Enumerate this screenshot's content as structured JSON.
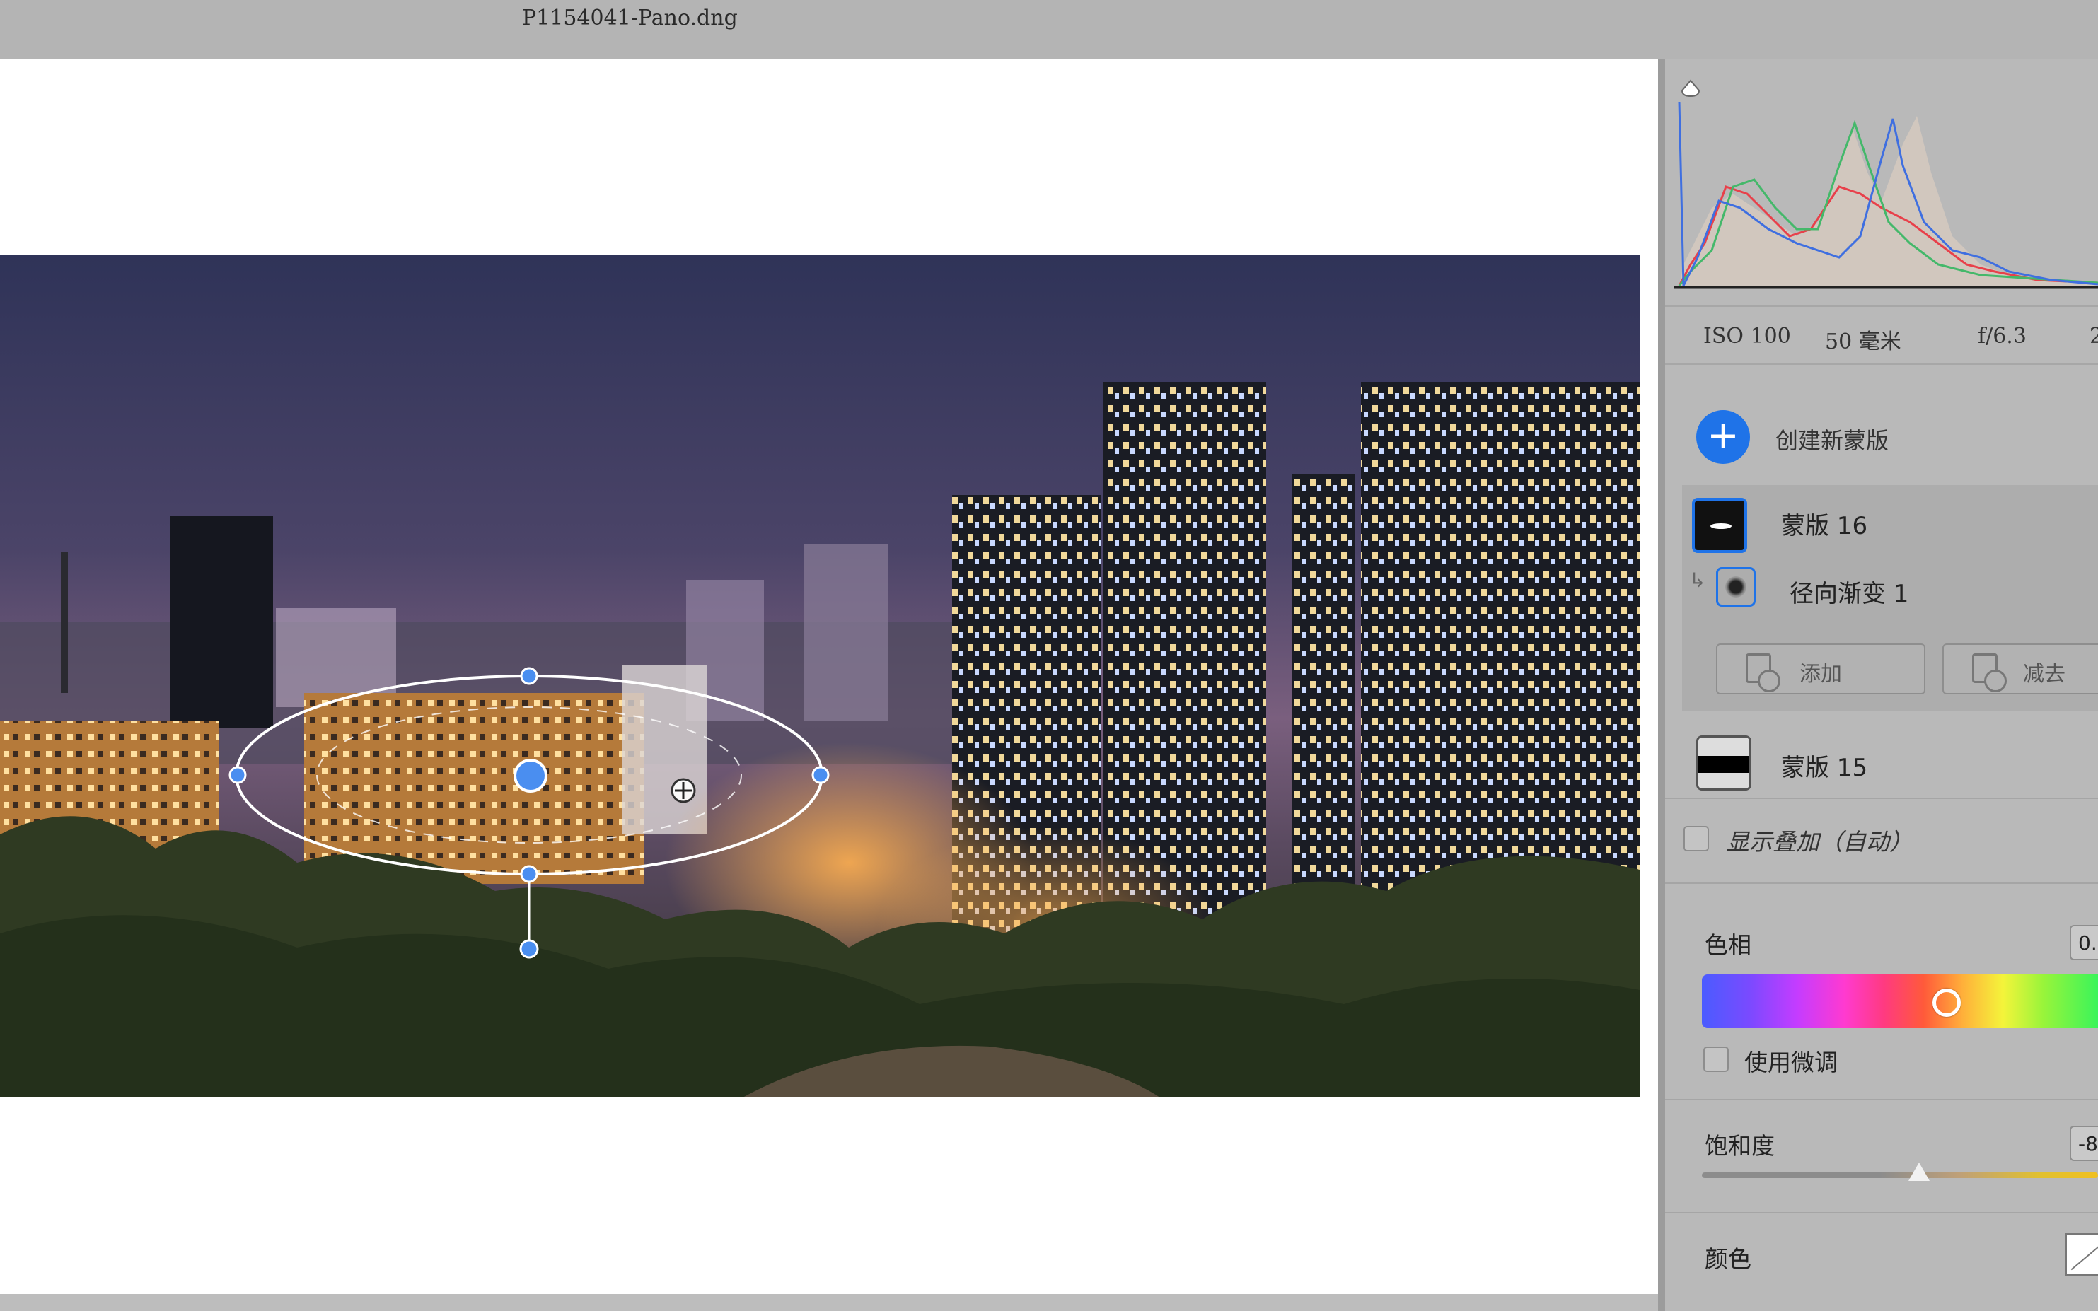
{
  "window": {
    "title": "P1154041-Pano.dng"
  },
  "camera_info": {
    "iso": "ISO 100",
    "focal": "50 毫米",
    "aperture": "f/6.3",
    "extra": "2"
  },
  "masks": {
    "create_label": "创建新蒙版",
    "items": [
      {
        "name": "蒙版 16",
        "selected": true,
        "components": [
          {
            "name": "径向渐变 1",
            "icon": "radial-gradient-icon"
          }
        ]
      },
      {
        "name": "蒙版 15",
        "selected": false
      }
    ],
    "add_label": "添加",
    "subtract_label": "减去"
  },
  "overlay": {
    "label": "显示叠加（自动）",
    "checked": false
  },
  "hue": {
    "label": "色相",
    "value": "0.",
    "fine_tune_label": "使用微调",
    "fine_tune_checked": false
  },
  "saturation": {
    "label": "饱和度",
    "value": "-8"
  },
  "color": {
    "label": "颜色"
  },
  "accent_color": "#1f73e8"
}
